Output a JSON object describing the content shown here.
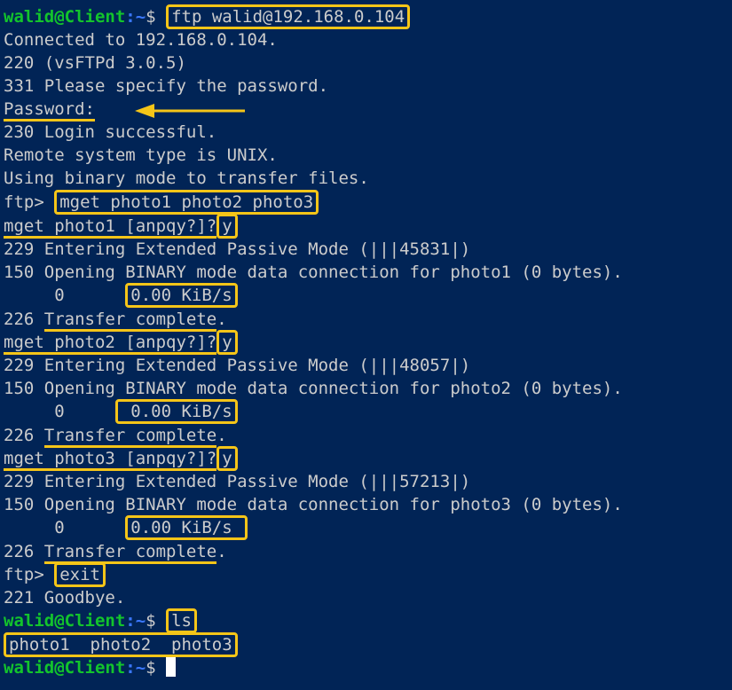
{
  "prompt": {
    "user": "walid@Client",
    "path": ":~",
    "symbol": "$ "
  },
  "lines": {
    "cmd_ftp": "ftp walid@192.168.0.104",
    "l2": "Connected to 192.168.0.104.",
    "l3": "220 (vsFTPd 3.0.5)",
    "l4": "331 Please specify the password.",
    "l5": "Password:",
    "l6": "230 Login successful.",
    "l7": "Remote system type is UNIX.",
    "l8": "Using binary mode to transfer files.",
    "ftp_prompt": "ftp> ",
    "cmd_mget": "mget photo1 photo2 photo3",
    "q1": "mget photo1 [anpqy?]?",
    "a1": "y",
    "l11": "229 Entering Extended Passive Mode (|||45831|)",
    "l12": "150 Opening BINARY mode data connection for photo1 (0 bytes).",
    "bytes1": "     0      ",
    "rate1": "0.00 KiB/s",
    "code226": "226 ",
    "transfer_complete": "Transfer complete",
    "dot": ".",
    "q2": "mget photo2 [anpqy?]?",
    "a2": "y",
    "l16": "229 Entering Extended Passive Mode (|||48057|)",
    "l17": "150 Opening BINARY mode data connection for photo2 (0 bytes).",
    "bytes2": "     0     ",
    "rate2": " 0.00 KiB/s",
    "q3": "mget photo3 [anpqy?]?",
    "a3": "y",
    "l21": "229 Entering Extended Passive Mode (|||57213|)",
    "l22": "150 Opening BINARY mode data connection for photo3 (0 bytes).",
    "bytes3": "     0      ",
    "rate3": "0.00 KiB/s ",
    "cmd_exit": "exit",
    "l26": "221 Goodbye.",
    "cmd_ls": "ls",
    "ls_output": "photo1  photo2  photo3"
  },
  "colors": {
    "background": "#012456",
    "text": "#cccccc",
    "highlight": "#f5c518",
    "user": "#13c42c",
    "path": "#3b78ff"
  }
}
